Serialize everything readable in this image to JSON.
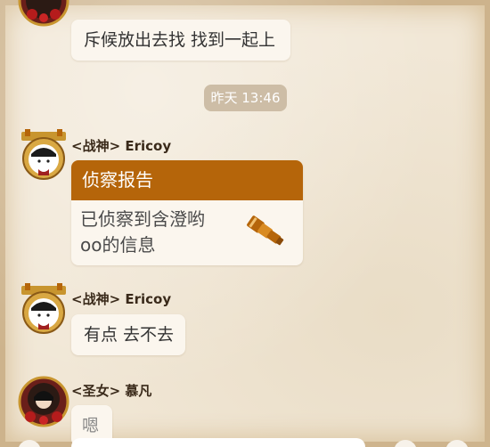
{
  "messages": [
    {
      "text": "斥候放出去找 找到一起上"
    },
    {
      "sender": "<战神> Ericoy"
    },
    {
      "sender": "<战神> Ericoy",
      "text": "有点 去不去"
    },
    {
      "sender": "<圣女> 慕凡",
      "text": "嗯"
    }
  ],
  "timestamp": "昨天 13:46",
  "card": {
    "title": "侦察报告",
    "line1": "已侦察到含澄哟",
    "line2": "oo的信息",
    "icon": "telescope-icon"
  },
  "colors": {
    "card_header": "#b5650a",
    "bubble": "#fbf6ee",
    "background": "#f1e7d6",
    "timestamp_bg": "#cdbda6"
  }
}
